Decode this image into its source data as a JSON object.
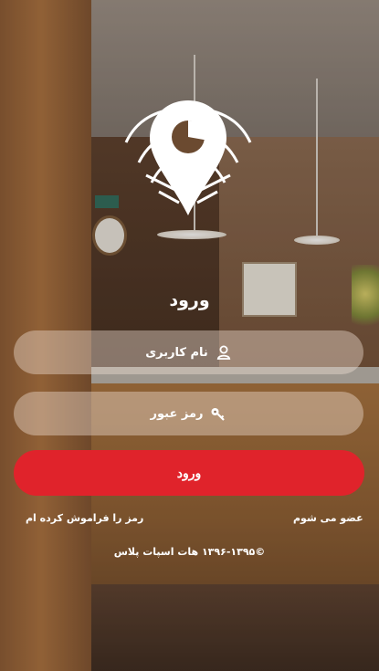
{
  "login": {
    "title": "ورود",
    "username_placeholder": "نام کاربری",
    "password_placeholder": "رمز عبور",
    "submit_label": "ورود",
    "forgot_password": "رمز را فراموش کرده ام",
    "register": "عضو می شوم",
    "copyright": "©۱۳۹۶-۱۳۹۵ هات اسپات پلاس"
  },
  "colors": {
    "primary_button": "#e0232b",
    "field_background": "rgba(240,225,212,0.42)",
    "text": "#ffffff"
  },
  "icons": {
    "logo": "location-pin-wifi-icon",
    "username": "user-icon",
    "password": "key-icon"
  }
}
